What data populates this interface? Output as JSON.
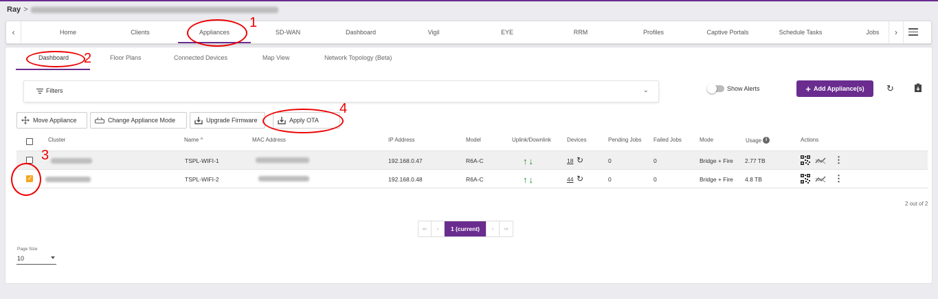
{
  "breadcrumb": {
    "root": "Ray",
    "separator": ">"
  },
  "nav": {
    "items": [
      "Home",
      "Clients",
      "Appliances",
      "SD-WAN",
      "Dashboard",
      "Vigil",
      "EYE",
      "RRM",
      "Profiles",
      "Captive Portals",
      "Schedule Tasks",
      "Jobs"
    ],
    "active": "Appliances",
    "left_arrow": "‹",
    "right_arrow": "›"
  },
  "subtabs": [
    "Dashboard",
    "Floor Plans",
    "Connected Devices",
    "Map View",
    "Network Topology (Beta)"
  ],
  "filters": {
    "label": "Filters"
  },
  "show_alerts": {
    "label": "Show Alerts",
    "enabled": false
  },
  "add_button": {
    "label": "Add Appliance(s)"
  },
  "actions": {
    "move": "Move Appliance",
    "change_mode": "Change Appliance Mode",
    "upgrade": "Upgrade Firmware",
    "apply_ota": "Apply OTA"
  },
  "table": {
    "headers": {
      "cluster": "Cluster",
      "name": "Name",
      "mac": "MAC Address",
      "ip": "IP Address",
      "model": "Model",
      "uplink": "Uplink/Downlink",
      "devices": "Devices",
      "pending": "Pending Jobs",
      "failed": "Failed Jobs",
      "mode": "Mode",
      "usage": "Usage",
      "actions": "Actions"
    },
    "rows": [
      {
        "name": "TSPL-WIFI-1",
        "ip": "192.168.0.47",
        "model": "R6A-C",
        "devices": "18",
        "pending": "0",
        "failed": "0",
        "mode": "Bridge + Fire",
        "usage": "2.77 TB",
        "checked": false
      },
      {
        "name": "TSPL-WIFI-2",
        "ip": "192.168.0.48",
        "model": "R6A-C",
        "devices": "44",
        "pending": "0",
        "failed": "0",
        "mode": "Bridge + Fire",
        "usage": "4.8 TB",
        "checked": true
      }
    ]
  },
  "count_label": "2 out of 2",
  "pager": {
    "first": "«‹",
    "prev": "‹",
    "current": "1 (current)",
    "next": "›",
    "last": "›»"
  },
  "page_size": {
    "label": "Page Size",
    "value": "10"
  },
  "annotations": [
    "1",
    "2",
    "3",
    "4"
  ],
  "colors": {
    "accent": "#6a2c8e",
    "annotation": "#e00000",
    "checkbox": "#f5a623",
    "arrows": "#1e8a1e"
  }
}
